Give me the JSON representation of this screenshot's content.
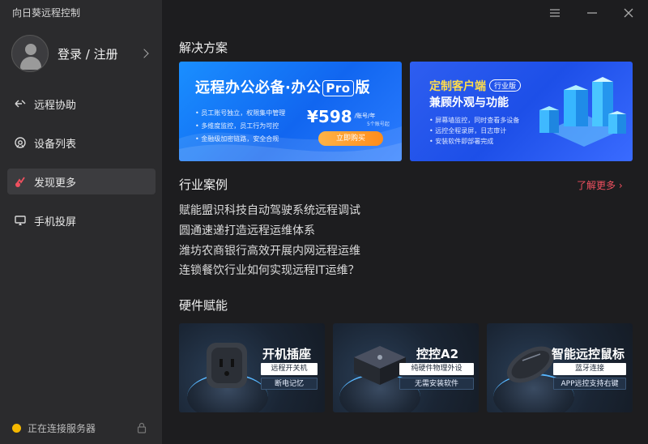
{
  "app": {
    "title": "向日葵远程控制"
  },
  "login": {
    "label": "登录 / 注册"
  },
  "sidebar": {
    "items": [
      {
        "label": "远程协助",
        "icon": "remote-assist-icon"
      },
      {
        "label": "设备列表",
        "icon": "device-list-icon"
      },
      {
        "label": "发现更多",
        "icon": "discover-icon"
      },
      {
        "label": "手机投屏",
        "icon": "screen-mirror-icon"
      }
    ]
  },
  "status": {
    "text": "正在连接服务器",
    "color": "#f5b800"
  },
  "solutions": {
    "title": "解决方案",
    "banner1": {
      "title_pre": "远程办公必备·办公",
      "title_badge": "Pro",
      "title_post": "版",
      "features": [
        "员工账号独立，权限集中管理",
        "多维度监控，员工行为可控",
        "金融级加密链路，安全合规"
      ],
      "price": "¥598",
      "price_unit": "/账号/年",
      "price_sub": "5个账号起",
      "buy_label": "立即购买"
    },
    "banner2": {
      "title1": "定制客户端",
      "tag": "行业版",
      "title2": "兼顾外观与功能",
      "features": [
        "屏幕墙监控，同时查看多设备",
        "远控全程录屏，日志审计",
        "安装软件即部署完成"
      ]
    }
  },
  "cases": {
    "title": "行业案例",
    "more_label": "了解更多",
    "items": [
      "赋能盟识科技自动驾驶系统远程调试",
      "圆通速递打造远程运维体系",
      "潍坊农商银行高效开展内网远程运维",
      "连锁餐饮行业如何实现远程IT运维？"
    ]
  },
  "hardware": {
    "title": "硬件赋能",
    "cards": [
      {
        "title": "开机插座",
        "tag1": "远程开关机",
        "tag2": "断电记忆"
      },
      {
        "title": "控控A2",
        "tag1": "纯硬件物理外设",
        "tag2": "无需安装软件"
      },
      {
        "title": "智能远控鼠标",
        "tag1": "蓝牙连接",
        "tag2": "APP远控支持右键"
      }
    ]
  },
  "colors": {
    "accent_link": "#f0505f",
    "sidebar_bg": "#2b2b2d",
    "main_bg": "#1d1d1f"
  }
}
